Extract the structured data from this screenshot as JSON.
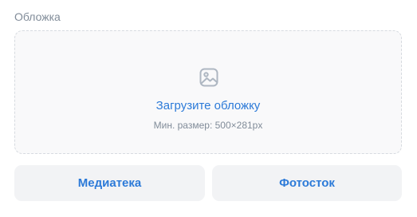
{
  "cover": {
    "label": "Обложка",
    "dropzone": {
      "icon": "image-icon",
      "upload_label": "Загрузите обложку",
      "hint": "Мин. размер: 500×281px"
    },
    "buttons": {
      "media_library": "Медиатека",
      "photostock": "Фотосток"
    }
  },
  "colors": {
    "accent": "#2c7ad8",
    "secondary_text": "#818c99",
    "button_bg": "#f2f3f5",
    "dropzone_bg": "#f9f9fa",
    "dropzone_border": "#d7dbe0"
  }
}
